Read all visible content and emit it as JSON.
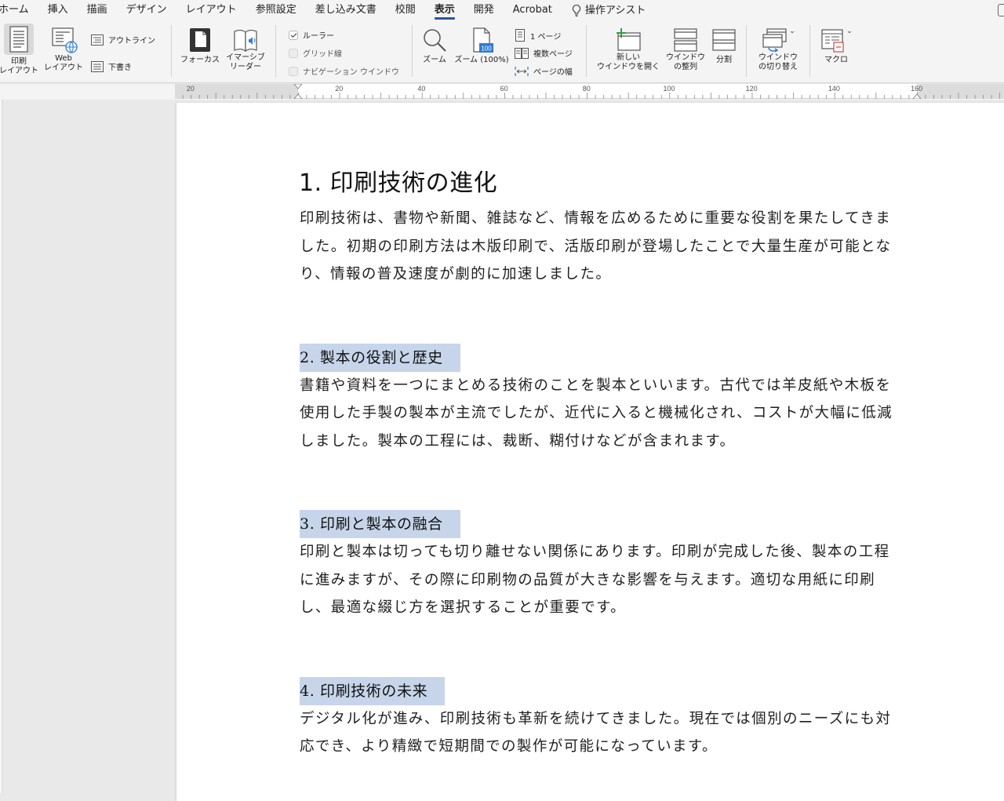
{
  "menu": {
    "tabs": [
      "ホーム",
      "挿入",
      "描画",
      "デザイン",
      "レイアウト",
      "参照設定",
      "差し込み文書",
      "校閲",
      "表示",
      "開発",
      "Acrobat"
    ],
    "active_tab": "表示",
    "assist_label": "操作アシスト"
  },
  "ribbon": {
    "views": {
      "print_layout": "印刷\nレイアウト",
      "web_layout": "Web\nレイアウト",
      "outline": "アウトライン",
      "draft": "下書き"
    },
    "immersive": {
      "focus": "フォーカス",
      "reader": "イマーシブ\nリーダー"
    },
    "show": {
      "ruler": {
        "label": "ルーラー",
        "checked": true
      },
      "gridlines": {
        "label": "グリッド線",
        "checked": false
      },
      "nav_pane": {
        "label": "ナビゲーション ウインドウ",
        "checked": false
      }
    },
    "zoom": {
      "zoom": "ズーム",
      "zoom100": "ズーム (100%)",
      "zoom100_badge": "100",
      "one_page": "1 ページ",
      "multi_page": "複数ページ",
      "page_width": "ページの幅"
    },
    "window": {
      "new_window": "新しい\nウインドウを開く",
      "arrange": "ウインドウ\nの整列",
      "split": "分割",
      "switch": "ウインドウ\nの切り替え"
    },
    "macros": {
      "macros": "マクロ"
    }
  },
  "ruler": {
    "labels": [
      "20",
      "20",
      "40",
      "60",
      "80",
      "100",
      "120",
      "140",
      "160"
    ]
  },
  "document": {
    "title": "1. 印刷技術の進化",
    "sections": [
      {
        "heading": null,
        "lines": [
          "印刷技術は、書物や新聞、雑誌など、情報を広めるために重要な役割を果たしてきま",
          "した。初期の印刷方法は木版印刷で、活版印刷が登場したことで大量生産が可能とな",
          "り、情報の普及速度が劇的に加速しました。"
        ]
      },
      {
        "heading": "2. 製本の役割と歴史",
        "lines": [
          "書籍や資料を一つにまとめる技術のことを製本といいます。古代では羊皮紙や木板を",
          "使用した手製の製本が主流でしたが、近代に入ると機械化され、コストが大幅に低減",
          "しました。製本の工程には、裁断、糊付けなどが含まれます。"
        ]
      },
      {
        "heading": "3. 印刷と製本の融合",
        "lines": [
          "印刷と製本は切っても切り離せない関係にあります。印刷が完成した後、製本の工程",
          "に進みますが、その際に印刷物の品質が大きな影響を与えます。適切な用紙に印刷",
          "し、最適な綴じ方を選択することが重要です。"
        ]
      },
      {
        "heading": "4. 印刷技術の未来",
        "lines": [
          "デジタル化が進み、印刷技術も革新を続けてきました。現在では個別のニーズにも対",
          "応でき、より精緻で短期間での製作が可能になっています。"
        ]
      }
    ],
    "heading_highlight": "#c6d5ea"
  }
}
